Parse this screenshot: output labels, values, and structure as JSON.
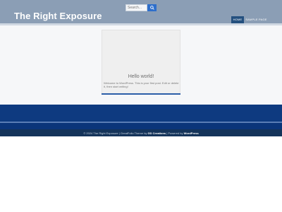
{
  "header": {
    "site_title": "The Right Exposure",
    "search": {
      "placeholder": "Search...",
      "value": ""
    },
    "nav": [
      {
        "label": "HOME",
        "active": true
      },
      {
        "label": "SAMPLE PAGE",
        "active": false
      }
    ]
  },
  "post": {
    "title": "Hello world!",
    "excerpt": "Welcome to WordPress. This is your first post. Edit or delete it, then start writing!"
  },
  "footer": {
    "copyright": "© 2024 The Right Exposure | GreatFolio Theme by",
    "theme_author": "GD Creations",
    "powered_prefix": "| Powered by",
    "platform": "WordPress"
  },
  "colors": {
    "header_bg": "#8b9eb5",
    "nav_active": "#24507f",
    "search_button": "#2e6fcb",
    "band": "#0e3a80",
    "footer_bg": "#15345a"
  },
  "icons": {
    "search_button": "search-icon"
  }
}
